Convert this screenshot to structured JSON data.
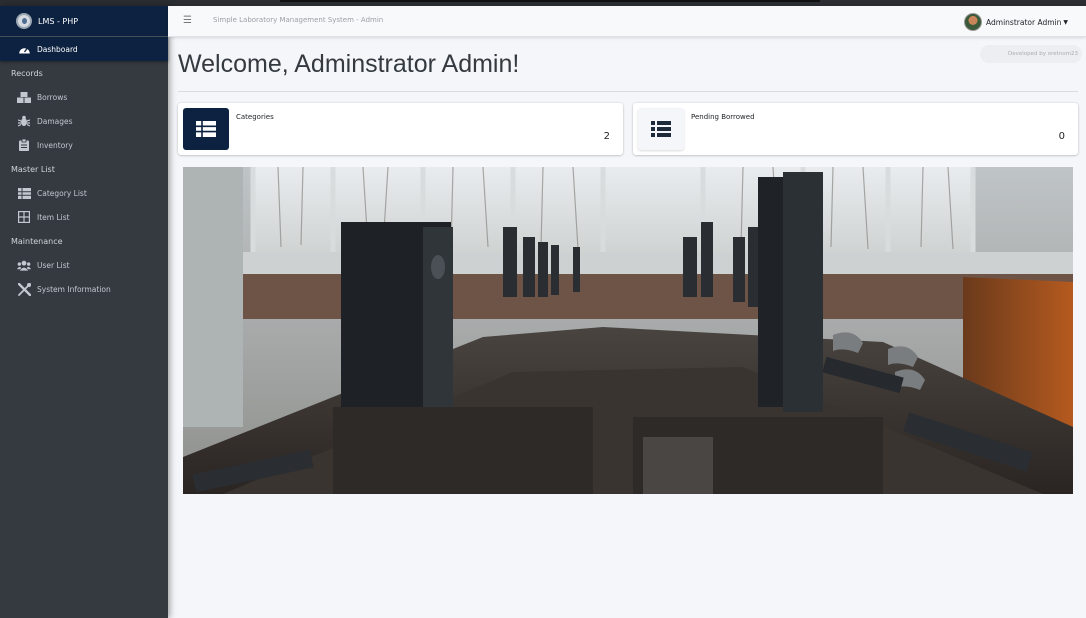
{
  "brand": {
    "name": "LMS - PHP"
  },
  "sidebar": {
    "active": {
      "label": "Dashboard",
      "icon": "tachometer-icon"
    },
    "sections": [
      {
        "header": "Records",
        "items": [
          {
            "label": "Borrows",
            "icon": "boxes-icon"
          },
          {
            "label": "Damages",
            "icon": "bug-icon"
          },
          {
            "label": "Inventory",
            "icon": "clipboard-icon"
          }
        ]
      },
      {
        "header": "Master List",
        "items": [
          {
            "label": "Category List",
            "icon": "table-icon"
          },
          {
            "label": "Item List",
            "icon": "grid-icon"
          }
        ]
      },
      {
        "header": "Maintenance",
        "items": [
          {
            "label": "User List",
            "icon": "users-icon"
          },
          {
            "label": "System Information",
            "icon": "tools-icon"
          }
        ]
      }
    ]
  },
  "navbar": {
    "title": "Simple Laboratory Management System - Admin",
    "user_name": "Adminstrator Admin"
  },
  "content": {
    "credit": "Developed by oretnom23",
    "welcome": "Welcome, Adminstrator Admin!",
    "cards": [
      {
        "title": "Categories",
        "value": "2",
        "icon": "th-list-icon"
      },
      {
        "title": "Pending Borrowed",
        "value": "0",
        "icon": "list-icon"
      }
    ]
  },
  "colors": {
    "sidebar_bg": "#343a40",
    "brand_bg": "#0d2240",
    "page_bg": "#f4f6f9"
  }
}
